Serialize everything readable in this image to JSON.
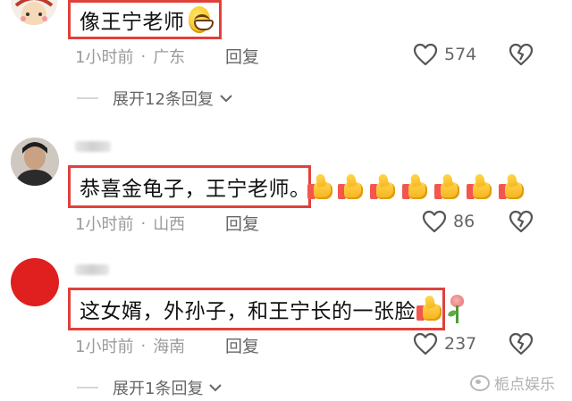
{
  "comments": [
    {
      "text": "像王宁老师",
      "time": "1小时前",
      "separator": "·",
      "location": "广东",
      "reply_label": "回复",
      "likes": "574",
      "expand_label": "展开12条回复"
    },
    {
      "text": "恭喜金龟子，王宁老师。",
      "time": "1小时前",
      "separator": "·",
      "location": "山西",
      "reply_label": "回复",
      "likes": "86"
    },
    {
      "text": "这女婿，外孙子，和王宁长的一张脸",
      "time": "1小时前",
      "separator": "·",
      "location": "海南",
      "reply_label": "回复",
      "likes": "237",
      "expand_label": "展开1条回复"
    }
  ],
  "icons": {
    "like": "heart-outline-icon",
    "dislike": "broken-heart-icon",
    "expand": "chevron-down-icon",
    "emoji_grin": "grinning-face-emoji",
    "emoji_thumb": "thumbs-up-emoji",
    "emoji_rose": "rose-emoji"
  },
  "watermark": "栀点娱乐",
  "colors": {
    "highlight_border": "#e0413b",
    "meta_text": "#9a9a9a",
    "action_text": "#666666"
  }
}
